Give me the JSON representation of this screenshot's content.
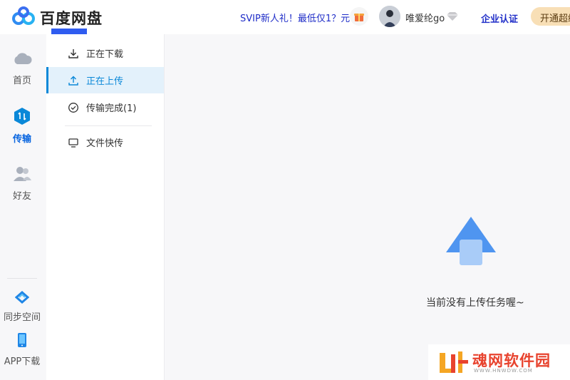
{
  "header": {
    "app_name": "百度网盘",
    "promo": "SVIP新人礼！最低仅1？元",
    "username": "唯爱纶go",
    "enterprise": "企业认证",
    "open_button": "开通超级"
  },
  "rail": {
    "items": [
      {
        "label": "首页",
        "icon": "cloud-icon",
        "active": false
      },
      {
        "label": "传输",
        "icon": "transfer-icon",
        "active": true
      },
      {
        "label": "好友",
        "icon": "friends-icon",
        "active": false
      },
      {
        "label": "同步空间",
        "icon": "sync-icon",
        "active": false
      },
      {
        "label": "APP下载",
        "icon": "phone-icon",
        "active": false
      }
    ]
  },
  "panel": {
    "items": [
      {
        "label": "正在下载",
        "icon": "download-icon"
      },
      {
        "label": "正在上传",
        "icon": "upload-icon"
      },
      {
        "label": "传输完成(1)",
        "icon": "check-circle-icon"
      },
      {
        "label": "文件快传",
        "icon": "monitor-icon"
      }
    ]
  },
  "main": {
    "empty_text": "当前没有上传任务喔~"
  },
  "watermark": {
    "title": "魂网软件园",
    "subtitle": "WWW.HNWDW.COM"
  },
  "colors": {
    "accent": "#0a88d8",
    "active_bg": "#e3f1fb",
    "brand_blue": "#1f2dc8",
    "upload_arrow": "#5b9ef2"
  }
}
